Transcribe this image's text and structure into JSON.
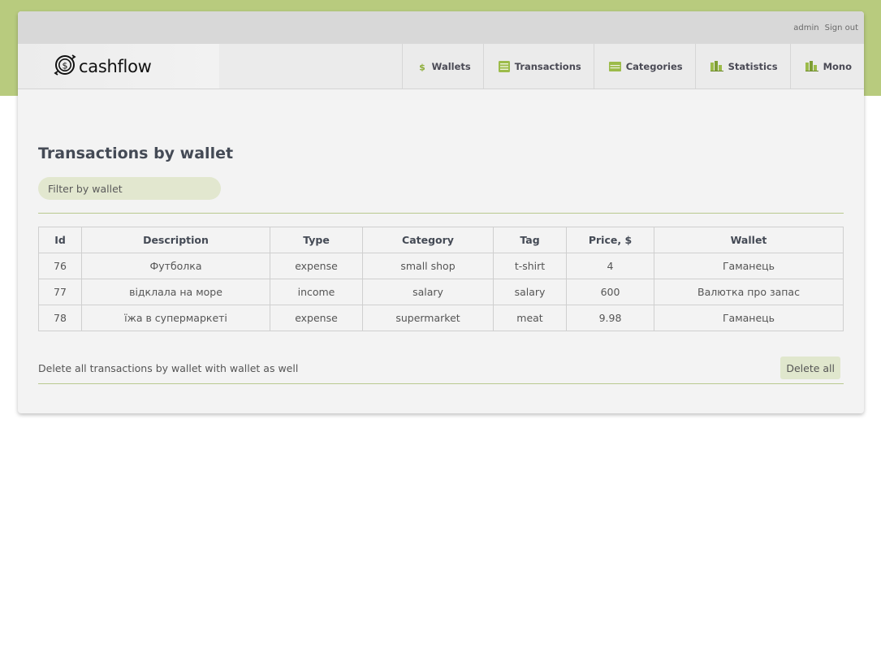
{
  "header": {
    "user": "admin",
    "signout": "Sign out",
    "logo": "cashflow"
  },
  "nav": {
    "items": [
      {
        "label": "Wallets",
        "icon": "dollar-icon"
      },
      {
        "label": "Transactions",
        "icon": "list-icon"
      },
      {
        "label": "Categories",
        "icon": "folder-icon"
      },
      {
        "label": "Statistics",
        "icon": "bar-chart-icon"
      },
      {
        "label": "Mono",
        "icon": "bar-chart-icon"
      }
    ]
  },
  "page": {
    "title": "Transactions by wallet",
    "filter_placeholder": "Filter by wallet"
  },
  "table": {
    "headers": [
      "Id",
      "Description",
      "Type",
      "Category",
      "Tag",
      "Price, $",
      "Wallet"
    ],
    "rows": [
      [
        "76",
        "Футболка",
        "expense",
        "small shop",
        "t-shirt",
        "4",
        "Гаманець"
      ],
      [
        "77",
        "відклала на море",
        "income",
        "salary",
        "salary",
        "600",
        "Валютка про запас"
      ],
      [
        "78",
        "їжа в супермаркеті",
        "expense",
        "supermarket",
        "meat",
        "9.98",
        "Гаманець"
      ]
    ]
  },
  "footer": {
    "text": "Delete all transactions by wallet with wallet as well",
    "button": "Delete all"
  },
  "colors": {
    "accent": "#b8cb7e",
    "accent_light": "#e2e7cf",
    "card": "#f3f3f3"
  }
}
